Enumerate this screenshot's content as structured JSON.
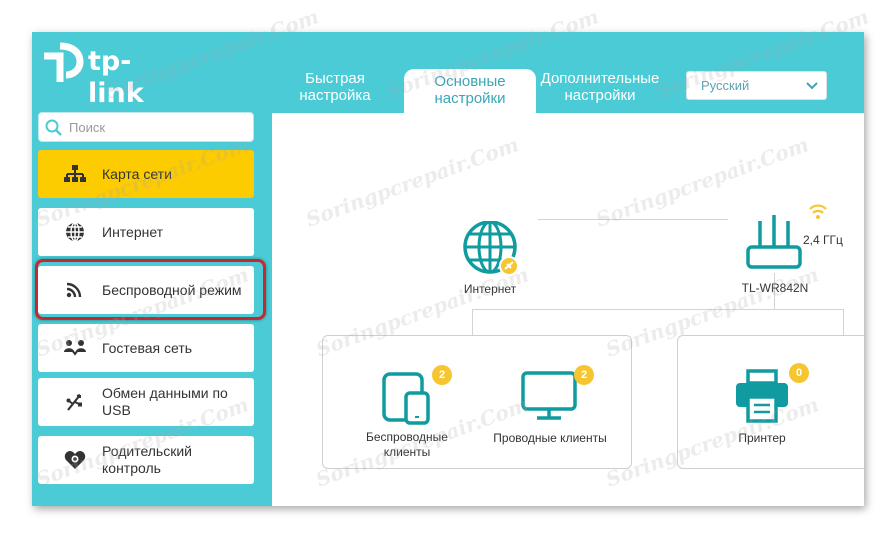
{
  "brand": {
    "logo_text": "tp-link"
  },
  "tabs": [
    {
      "label_line1": "Быстрая",
      "label_line2": "настройка"
    },
    {
      "label_line1": "Основные",
      "label_line2": "настройки"
    },
    {
      "label_line1": "Дополнительные",
      "label_line2": "настройки"
    }
  ],
  "language": {
    "selected": "Русский"
  },
  "search": {
    "placeholder": "Поиск"
  },
  "sidebar": {
    "items": [
      {
        "label": "Карта сети",
        "icon": "network-map-icon"
      },
      {
        "label": "Интернет",
        "icon": "globe-icon"
      },
      {
        "label": "Беспроводной режим",
        "icon": "wireless-icon"
      },
      {
        "label": "Гостевая сеть",
        "icon": "guest-network-icon"
      },
      {
        "label": "Обмен данными по USB",
        "icon": "usb-icon"
      },
      {
        "label": "Родительский контроль",
        "icon": "parental-control-icon"
      }
    ]
  },
  "map": {
    "internet_label": "Интернет",
    "router_label": "TL-WR842N",
    "router_band": "2,4 ГГц",
    "wireless_clients_line1": "Беспроводные",
    "wireless_clients_line2": "клиенты",
    "wireless_clients_count": "2",
    "wired_clients_label": "Проводные клиенты",
    "wired_clients_count": "2",
    "printer_label": "Принтер",
    "printer_count": "0"
  },
  "watermark": {
    "text": "Soringpcrepair.Com"
  },
  "colors": {
    "teal": "#4acbd6",
    "accent": "#0f9b9f",
    "selected": "#fccb00",
    "badge": "#f6c631",
    "highlight": "#c5282e"
  }
}
